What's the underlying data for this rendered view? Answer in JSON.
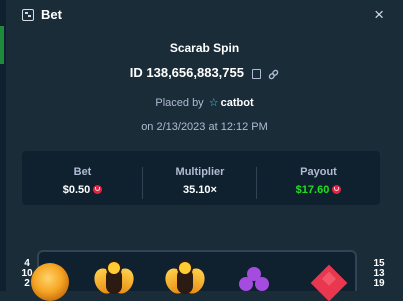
{
  "modal": {
    "title": "Bet",
    "close_label": "×"
  },
  "bet": {
    "game_name": "Scarab Spin",
    "id_text": "ID 138,656,883,755",
    "placed_prefix": "Placed by",
    "user": "catbot",
    "date_text": "on 2/13/2023 at 12:12 PM"
  },
  "stats": [
    {
      "label": "Bet",
      "value": "$0.50",
      "currency_icon": "ruby-gem-icon",
      "color": "#ffffff"
    },
    {
      "label": "Multiplier",
      "value": "35.10×",
      "color": "#ffffff"
    },
    {
      "label": "Payout",
      "value": "$17.60",
      "currency_icon": "ruby-gem-icon",
      "color": "#1fe01f"
    }
  ],
  "reel": {
    "left_numbers": [
      "4",
      "10",
      "2"
    ],
    "right_numbers": [
      "15",
      "13",
      "19"
    ],
    "symbols": [
      "coin-icon",
      "scarab-icon",
      "scarab-icon",
      "club-icon",
      "diamond-icon"
    ]
  },
  "colors": {
    "background": "#1a2c38",
    "panel": "#0f212e",
    "muted_text": "#b1bad3",
    "accent_star": "#3dd6f0",
    "payout_green": "#1fe01f",
    "gem_red": "#e02742"
  }
}
